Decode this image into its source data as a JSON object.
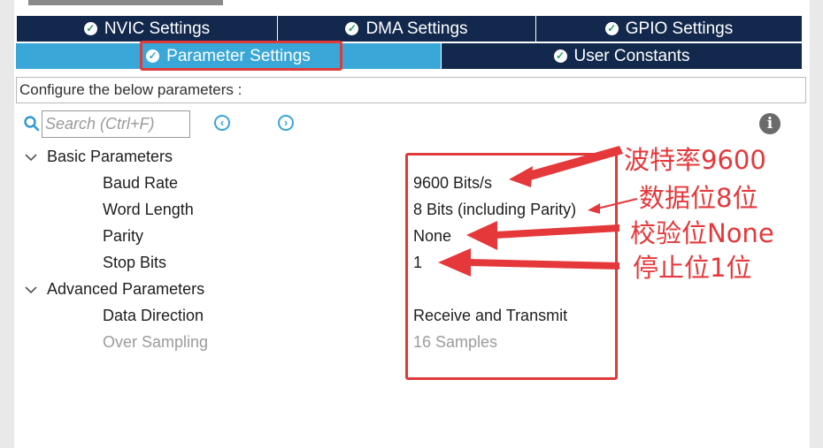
{
  "tabs_row1": [
    {
      "label": "NVIC Settings"
    },
    {
      "label": "DMA Settings"
    },
    {
      "label": "GPIO Settings"
    }
  ],
  "tabs_row2": [
    {
      "label": "Parameter Settings",
      "active": true
    },
    {
      "label": "User Constants",
      "active": false
    }
  ],
  "info_bar": "Configure the below parameters :",
  "search": {
    "placeholder": "Search (Ctrl+F)"
  },
  "groups": {
    "basic": {
      "label": "Basic Parameters",
      "params": [
        {
          "name": "Baud Rate",
          "value": "9600 Bits/s"
        },
        {
          "name": "Word Length",
          "value": "8 Bits (including Parity)"
        },
        {
          "name": "Parity",
          "value": "None"
        },
        {
          "name": "Stop Bits",
          "value": "1"
        }
      ]
    },
    "advanced": {
      "label": "Advanced Parameters",
      "params": [
        {
          "name": "Data Direction",
          "value": "Receive and Transmit"
        },
        {
          "name": "Over Sampling",
          "value": "16 Samples",
          "disabled": true
        }
      ]
    }
  },
  "annotations": {
    "baud": "波特率9600",
    "word": "数据位8位",
    "parity": "校验位None",
    "stop": "停止位1位"
  },
  "colors": {
    "tab_dark": "#12294d",
    "tab_active": "#3aa7d9",
    "annotation_red": "#e03a3a"
  },
  "icons": {
    "tab_status": "check-circle-icon",
    "search": "search-icon",
    "prev": "chevron-left-circle-icon",
    "next": "chevron-right-circle-icon",
    "info": "info-icon",
    "expand": "chevron-down-icon"
  }
}
